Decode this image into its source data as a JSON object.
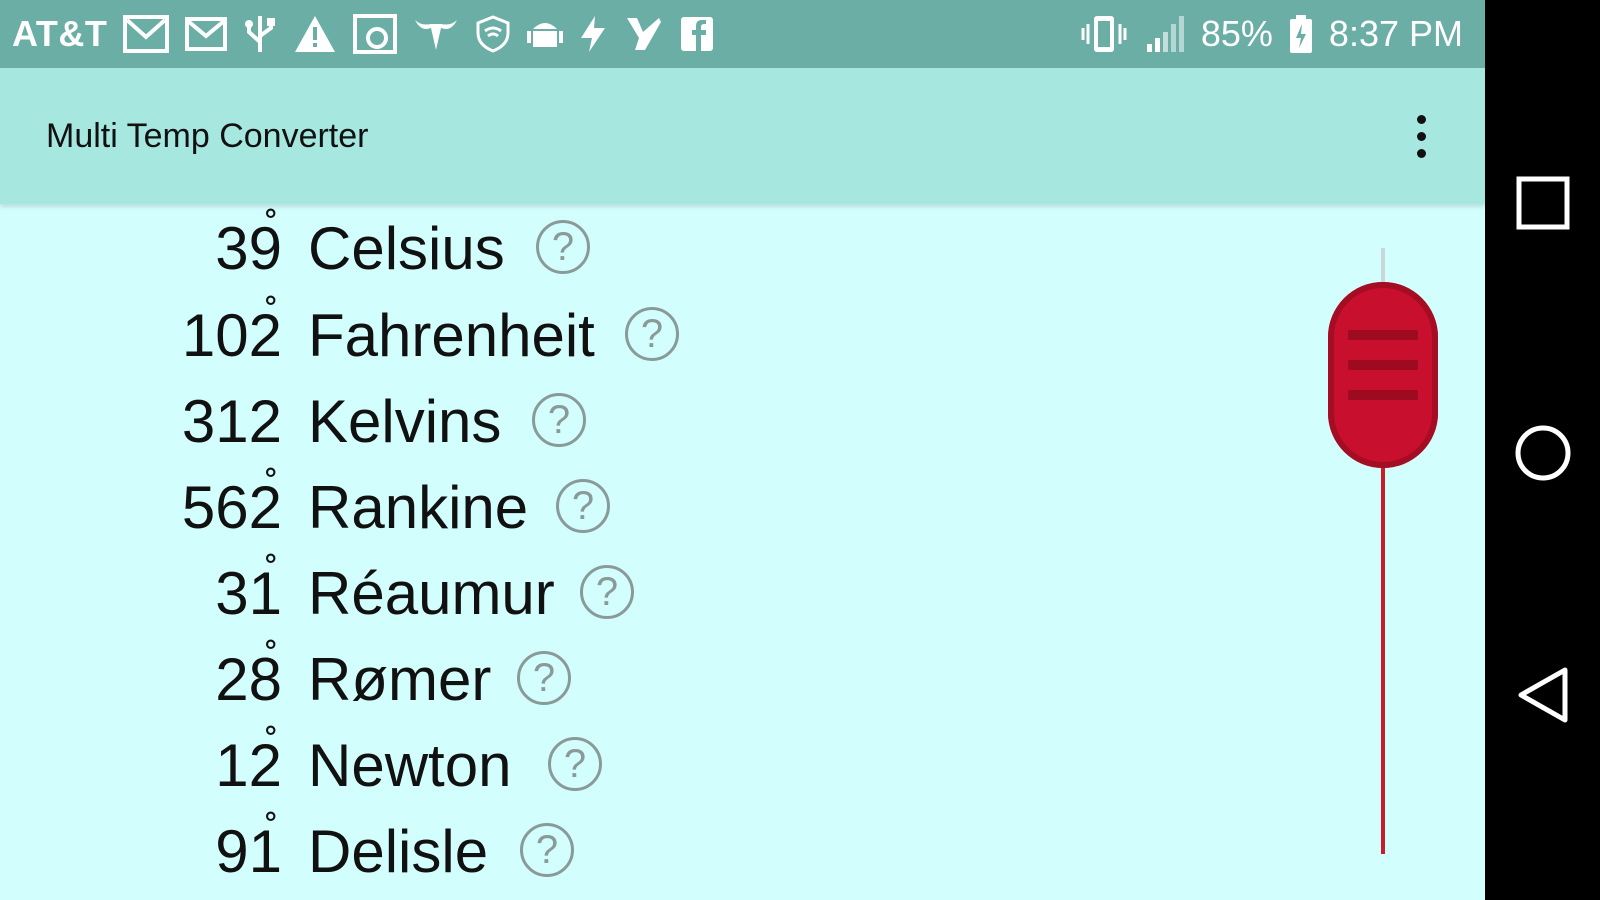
{
  "status_bar": {
    "carrier": "AT&T",
    "battery": "85%",
    "time": "8:37 PM",
    "left_icons": [
      "gmail-icon",
      "mail-icon",
      "usb-icon",
      "warning-icon",
      "photo-icon",
      "bull-icon",
      "wifi-shield-icon",
      "android-icon",
      "lightning-icon",
      "checkmark-icon",
      "facebook-icon"
    ],
    "right_icons": [
      "vibrate-icon",
      "signal-icon",
      "battery-icon"
    ]
  },
  "app_bar": {
    "title": "Multi Temp Converter",
    "menu_icon": "more-vert-icon"
  },
  "temperatures": [
    {
      "value": "39",
      "degree": "˚",
      "scale": "Celsius",
      "help": "?"
    },
    {
      "value": "102",
      "degree": "˚",
      "scale": "Fahrenheit",
      "help": "?"
    },
    {
      "value": "312",
      "degree": "",
      "scale": "Kelvins",
      "help": "?"
    },
    {
      "value": "562",
      "degree": "˚",
      "scale": "Rankine",
      "help": "?"
    },
    {
      "value": "31",
      "degree": "˚",
      "scale": "Réaumur",
      "help": "?"
    },
    {
      "value": "28",
      "degree": "˚",
      "scale": "Rømer",
      "help": "?"
    },
    {
      "value": "12",
      "degree": "˚",
      "scale": "Newton",
      "help": "?"
    },
    {
      "value": "91",
      "degree": "˚",
      "scale": "Delisle",
      "help": "?"
    }
  ],
  "slider": {
    "level": 0.07,
    "thumb_color": "#c8102e",
    "track_color": "#cc1c2c"
  },
  "colors": {
    "status_bar": "#6aaea6",
    "app_bar": "#a6e8e0",
    "content_bg": "#d2fffd"
  },
  "nav_bar": {
    "buttons": [
      "recents-icon",
      "home-icon",
      "back-icon"
    ]
  }
}
